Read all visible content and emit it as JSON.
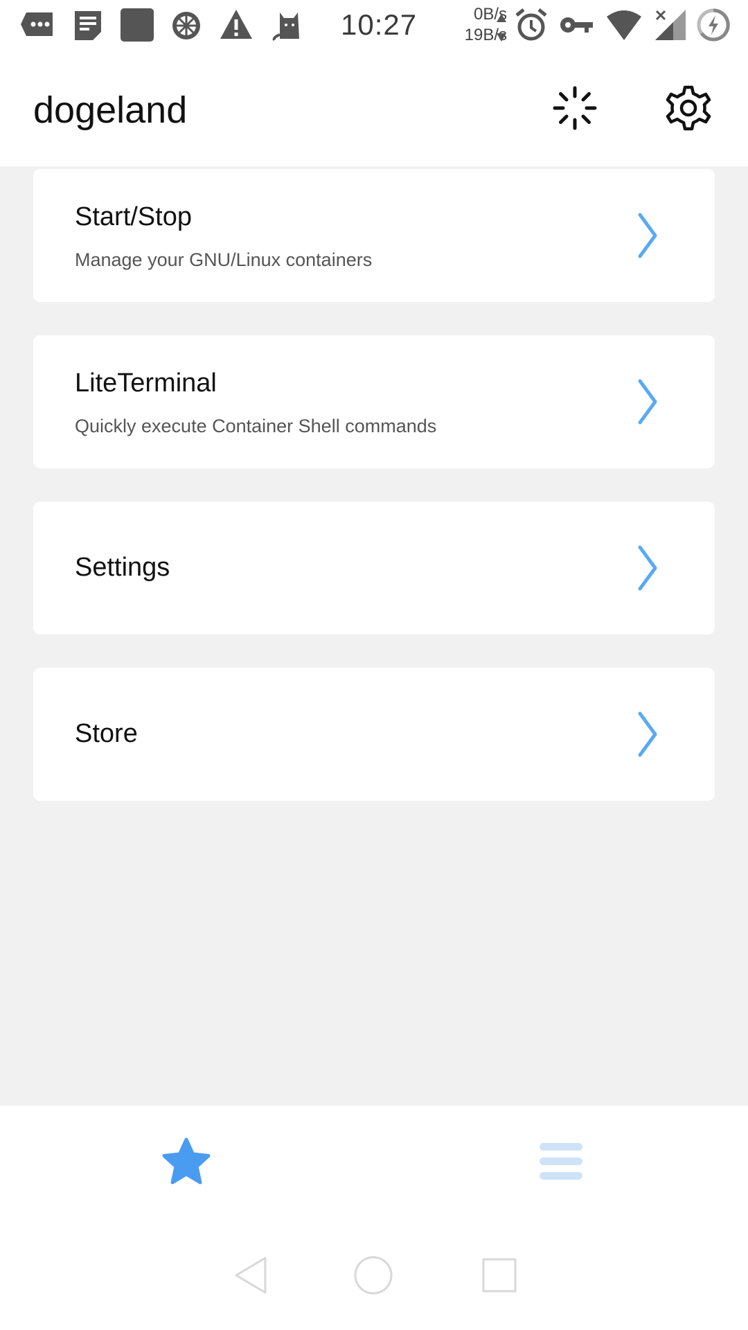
{
  "status_bar": {
    "time": "10:27",
    "upload_speed": "0B/s",
    "download_speed": "19B/s",
    "icons": [
      "message-icon",
      "notes-icon",
      "app-icon",
      "orange-icon",
      "warning-icon",
      "cat-icon",
      "alarm-icon",
      "vpn-key-icon",
      "wifi-icon",
      "signal-icon",
      "battery-charging-icon"
    ]
  },
  "app_bar": {
    "title": "dogeland",
    "loading_icon": "loading-spinner-icon",
    "settings_icon": "gear-icon"
  },
  "menu": {
    "items": [
      {
        "title": "Start/Stop",
        "subtitle": "Manage your GNU/Linux containers"
      },
      {
        "title": "LiteTerminal",
        "subtitle": "Quickly execute Container Shell commands"
      },
      {
        "title": "Settings",
        "subtitle": ""
      },
      {
        "title": "Store",
        "subtitle": ""
      }
    ],
    "chevron_icon": "chevron-right-icon"
  },
  "bottom_nav": {
    "items": [
      {
        "icon": "star-icon",
        "active": true
      },
      {
        "icon": "menu-icon",
        "active": false
      }
    ]
  },
  "colors": {
    "accent": "#4a9cf0",
    "chevron": "#5aa9f2",
    "inactive_nav": "#cfe3f8",
    "background": "#f1f1f1",
    "card": "#ffffff"
  }
}
